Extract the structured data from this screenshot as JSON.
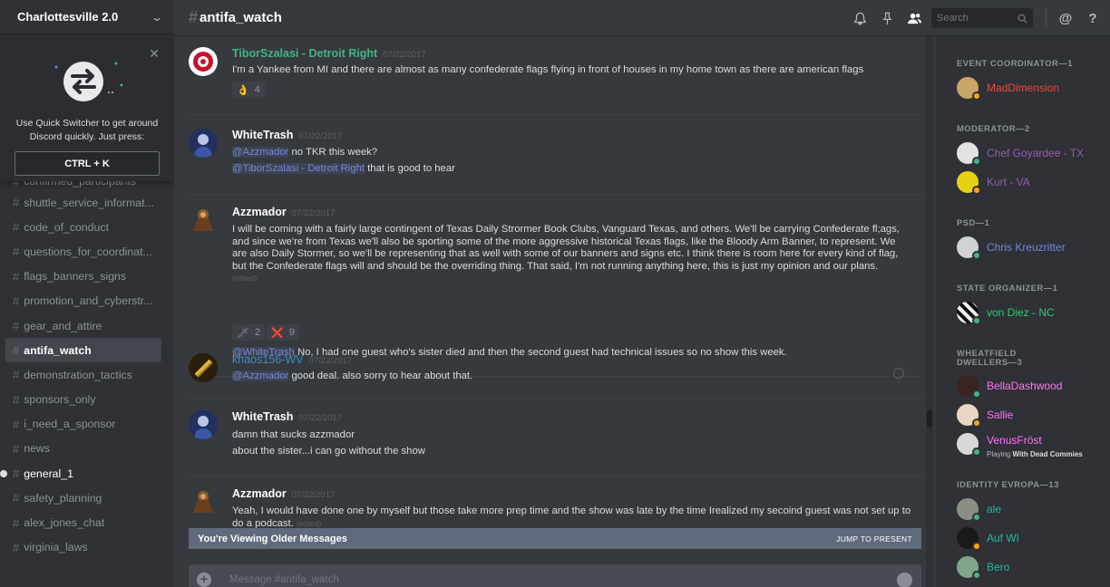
{
  "server": {
    "name": "Charlottesville 2.0"
  },
  "quick_switcher": {
    "text": "Use Quick Switcher to get around Discord quickly. Just press:",
    "shortcut": "CTRL + K"
  },
  "channels": [
    {
      "name": "confirmed_participants",
      "state": "partial"
    },
    {
      "name": "shuttle_service_informat...",
      "state": "normal"
    },
    {
      "name": "code_of_conduct",
      "state": "normal"
    },
    {
      "name": "questions_for_coordinat...",
      "state": "normal"
    },
    {
      "name": "flags_banners_signs",
      "state": "normal"
    },
    {
      "name": "promotion_and_cyberstr...",
      "state": "normal"
    },
    {
      "name": "gear_and_attire",
      "state": "normal"
    },
    {
      "name": "antifa_watch",
      "state": "active"
    },
    {
      "name": "demonstration_tactics",
      "state": "normal"
    },
    {
      "name": "sponsors_only",
      "state": "normal"
    },
    {
      "name": "i_need_a_sponsor",
      "state": "normal"
    },
    {
      "name": "news",
      "state": "normal"
    },
    {
      "name": "general_1",
      "state": "unread"
    },
    {
      "name": "safety_planning",
      "state": "normal"
    },
    {
      "name": "alex_jones_chat",
      "state": "normal"
    },
    {
      "name": "virginia_laws",
      "state": "normal"
    }
  ],
  "header": {
    "channel_name": "antifa_watch",
    "search_placeholder": "Search"
  },
  "messages": [
    {
      "author": "TiborSzalasi - Detroit Right",
      "author_color": "#43b581",
      "timestamp": "07/22/2017",
      "lines": [
        "I'm a Yankee from MI and there are almost as many confederate flags flying in front of houses in my home town as there are american flags"
      ],
      "reactions": [
        {
          "emoji": "👌",
          "count": "4"
        }
      ]
    },
    {
      "author": "WhiteTrash",
      "author_color": "#ffffff",
      "timestamp": "07/22/2017",
      "lines": [
        {
          "mention": "@Azzmador",
          "text": " no TKR this week?"
        },
        {
          "mention": "@TiborSzalasi - Detroit Right",
          "text": " that is good to hear"
        }
      ]
    },
    {
      "author": "Azzmador",
      "author_color": "#ffffff",
      "timestamp": "07/22/2017",
      "paragraph": "I will be coming with a fairly large contingent of Texas Daily Strormer Book Clubs, Vanguard Texas, and others. We'll be carrying Confederate fl;ags, and since we're from Texas we'll also be sporting some of the more aggressive historical Texas flags, like the Bloody Arm Banner, to represent. We are also Daily Stormer, so we'll be representing that as well with some of our banners and signs etc. I think there is room here for every kind of flag, but the Confederate flags will and should be the overriding thing. That said, I'm not running anything here, this is just my opinion and our plans.",
      "edited": "(edited)",
      "reactions": [
        {
          "emoji": "🗡",
          "count": "2"
        },
        {
          "emoji": "❌",
          "count": "9"
        }
      ],
      "followup": {
        "mention": "@WhiteTrash",
        "text": " No, I had one guest who's sister died and then the second guest had technical issues so no show this week."
      }
    },
    {
      "author": "khaos156-WV",
      "author_color": "#3a8fc9",
      "timestamp": "07/22/2017",
      "lines": [
        {
          "mention": "@Azzmador",
          "text": " good deal. also sorry to hear about that."
        }
      ]
    },
    {
      "author": "WhiteTrash",
      "author_color": "#ffffff",
      "timestamp": "07/22/2017",
      "lines": [
        "damn that sucks azzmador",
        "about the sister...i can go without the show"
      ]
    },
    {
      "author": "Azzmador",
      "author_color": "#ffffff",
      "timestamp": "07/22/2017",
      "paragraph": "Yeah, I would have done one by myself but those take more prep time and the show was late by the time Irealized my secoind guest was not set up to do a podcast.",
      "edited": "(edited)"
    }
  ],
  "banner": {
    "label": "You're Viewing Older Messages",
    "action": "JUMP TO PRESENT"
  },
  "composer": {
    "placeholder": "Message #antifa_watch"
  },
  "roles": [
    {
      "title": "EVENT COORDINATOR—1",
      "members": [
        {
          "name": "MadDimension",
          "color": "#e74c3c",
          "status": "#faa61a"
        }
      ]
    },
    {
      "title": "MODERATOR—2",
      "members": [
        {
          "name": "Chef Goyardee - TX",
          "color": "#9b59b6",
          "status": "#43b581"
        },
        {
          "name": "Kurt - VA",
          "color": "#9b59b6",
          "status": "#faa61a"
        }
      ]
    },
    {
      "title": "PSD—1",
      "members": [
        {
          "name": "Chris Kreuzritter",
          "color": "#7289da",
          "status": "#43b581"
        }
      ]
    },
    {
      "title": "STATE ORGANIZER—1",
      "members": [
        {
          "name": "von Diez - NC",
          "color": "#2ecc71",
          "status": "#43b581"
        }
      ]
    },
    {
      "title": "WHEATFIELD DWELLERS—3",
      "members": [
        {
          "name": "BellaDashwood",
          "color": "#ff73fa",
          "status": "#43b581"
        },
        {
          "name": "Sallie",
          "color": "#ff73fa",
          "status": "#faa61a"
        },
        {
          "name": "VenusFröst",
          "color": "#ff73fa",
          "status": "#43b581",
          "playing_prefix": "Playing ",
          "playing_game": "With Dead Commies"
        }
      ]
    },
    {
      "title": "IDENTITY EVROPA—13",
      "members": [
        {
          "name": "ale",
          "color": "#1abc9c",
          "status": "#43b581"
        },
        {
          "name": "Auf WI",
          "color": "#1abc9c",
          "status": "#faa61a"
        },
        {
          "name": "Bero",
          "color": "#1abc9c",
          "status": "#43b581"
        }
      ]
    }
  ]
}
